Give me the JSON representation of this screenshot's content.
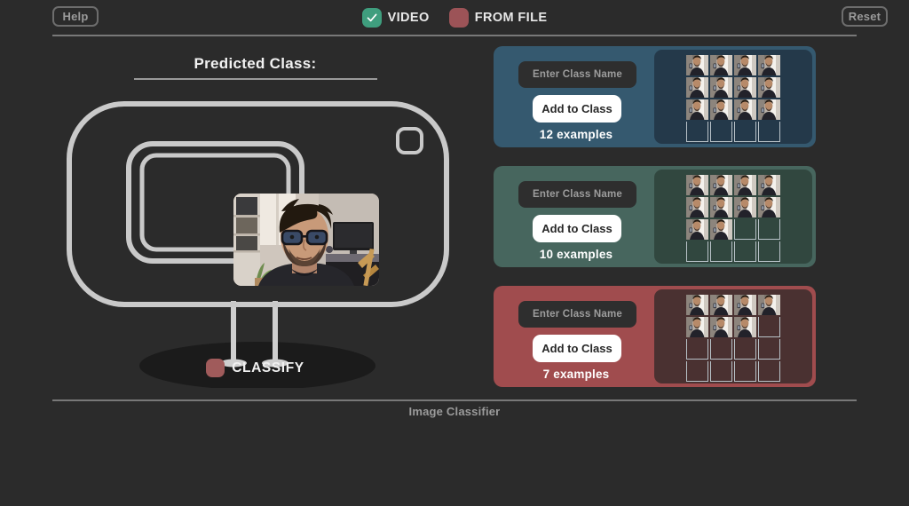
{
  "app": {
    "footer_label": "Image Classifier",
    "background_color": "#2b2b2b"
  },
  "topbar": {
    "help_label": "Help",
    "reset_label": "Reset",
    "modes": [
      {
        "label": "VIDEO",
        "checked": true,
        "color": "#3f9e7e",
        "icon": "check-icon"
      },
      {
        "label": "FROM FILE",
        "checked": false,
        "color": "#9c5357",
        "icon": "blank-icon"
      }
    ]
  },
  "predictor": {
    "title": "Predicted Class:",
    "predicted_value": "",
    "classify_label": "CLASSIFY",
    "classify_color": "#a05b5b",
    "webcam_active": true,
    "machine_outline_color": "#c9c9c9"
  },
  "classes": [
    {
      "name_placeholder": "Enter Class Name",
      "name_value": "",
      "add_label": "Add to Class",
      "examples_label": "12 examples",
      "example_count": 12,
      "slot_count": 16,
      "panel_color": "#35596f",
      "thumbs_bg": "#24394a"
    },
    {
      "name_placeholder": "Enter Class Name",
      "name_value": "",
      "add_label": "Add to Class",
      "examples_label": "10 examples",
      "example_count": 10,
      "slot_count": 16,
      "panel_color": "#47665e",
      "thumbs_bg": "#31473f"
    },
    {
      "name_placeholder": "Enter Class Name",
      "name_value": "",
      "add_label": "Add to Class",
      "examples_label": "7 examples",
      "example_count": 7,
      "slot_count": 16,
      "panel_color": "#a04c4e",
      "thumbs_bg": "#4a3131"
    }
  ]
}
